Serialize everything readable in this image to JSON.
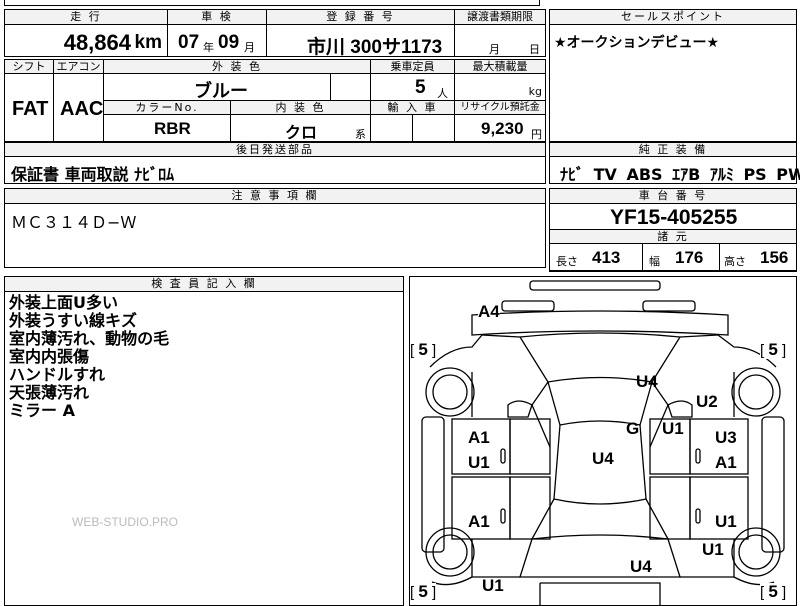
{
  "top_row": {
    "mileage_header": "走 行",
    "mileage_value": "48,864",
    "mileage_unit": "km",
    "inspection_header": "車 検",
    "inspection_year": "07",
    "inspection_year_unit": "年",
    "inspection_month": "09",
    "inspection_month_unit": "月",
    "registration_header": "登 録 番 号",
    "registration_value": "市川 300サ1173",
    "transfer_header": "譲渡書類期限",
    "transfer_month_unit": "月",
    "transfer_day_unit": "日",
    "selling_header": "セールスポイント",
    "selling_text": "★オークションデビュー★"
  },
  "row2": {
    "shift_header": "シフト",
    "shift_value": "FAT",
    "ac_header": "エアコン",
    "ac_value": "AAC",
    "exterior_color_header": "外 装 色",
    "exterior_color_value": "ブルー",
    "capacity_header": "乗車定員",
    "capacity_value": "5",
    "capacity_unit": "人",
    "max_load_header": "最大積載量",
    "max_load_unit": "kg",
    "color_no_header": "カラーNo.",
    "color_no_value": "RBR",
    "interior_color_header": "内 装 色",
    "interior_color_value": "クロ",
    "interior_color_suffix": "系",
    "import_header": "輸 入 車",
    "recycle_header": "リサイクル預託金",
    "recycle_value": "9,230",
    "recycle_unit": "円"
  },
  "delivery": {
    "header": "後日発送部品",
    "text": "保証書 車両取説 ﾅﾋﾞﾛﾑ"
  },
  "equipment": {
    "header": "純 正 装 備",
    "items": "ﾅﾋﾞ TV ABS ｴｱB ｱﾙﾐ PS PW"
  },
  "caution": {
    "header": "注 意 事 項 欄",
    "text": "ＭＣ３１４Ｄ−Ｗ"
  },
  "chassis": {
    "header": "車 台 番 号",
    "value": "YF15-405255",
    "spec_header": "諸 元",
    "length_label": "長さ",
    "length_value": "413",
    "width_label": "幅",
    "width_value": "176",
    "height_label": "高さ",
    "height_value": "156"
  },
  "inspector": {
    "header": "検 査 員 記 入 欄",
    "notes": [
      "外装上面U多い",
      "外装うすい線キズ",
      "室内薄汚れ、動物の毛",
      "室内内張傷",
      "ハンドルすれ",
      "天張薄汚れ",
      "ミラー A"
    ],
    "watermark": "WEB-STUDIO.PRO"
  },
  "diagram": {
    "tire_bracket_value": "5",
    "labels": {
      "a4": "A4",
      "u4_hood": "U4",
      "u2": "U2",
      "g": "G",
      "u1_pillar": "U1",
      "u3": "U3",
      "a1_right_front": "A1",
      "a1_left_front": "A1",
      "u1_left_front": "U1",
      "u4_roof": "U4",
      "a1_left_rear": "A1",
      "u1_right_rear": "U1",
      "u1_right_quarter": "U1",
      "u4_trunk": "U4",
      "u1_rear_left": "U1"
    }
  }
}
